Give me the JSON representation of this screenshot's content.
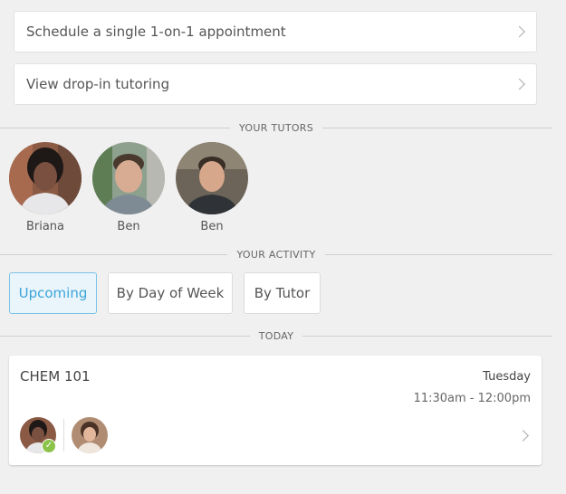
{
  "actions": {
    "schedule_label": "Schedule a single 1-on-1 appointment",
    "dropin_label": "View drop-in tutoring"
  },
  "sections": {
    "tutors": "YOUR TUTORS",
    "activity": "YOUR ACTIVITY",
    "today": "TODAY"
  },
  "tutors": [
    {
      "name": "Briana"
    },
    {
      "name": "Ben"
    },
    {
      "name": "Ben"
    }
  ],
  "activity_tabs": {
    "upcoming": "Upcoming",
    "by_day": "By Day of Week",
    "by_tutor": "By Tutor",
    "selected": "Upcoming"
  },
  "session": {
    "course": "CHEM 101",
    "day": "Tuesday",
    "time": "11:30am - 12:00pm"
  },
  "colors": {
    "accent": "#3aa4d8",
    "check_green": "#8bc34a",
    "background": "#f0f0f0"
  }
}
